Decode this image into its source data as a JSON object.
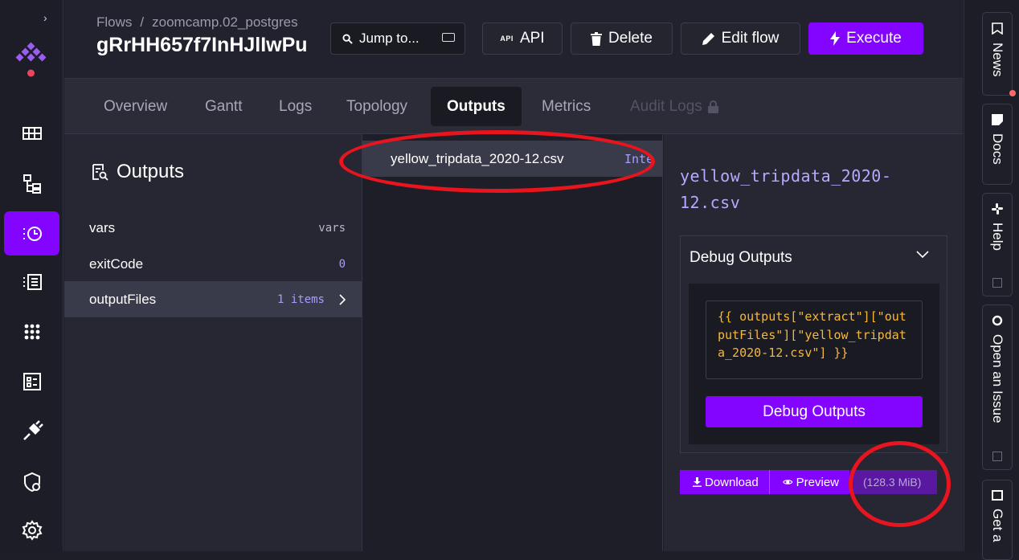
{
  "breadcrumb": {
    "root": "Flows",
    "separator": "/",
    "namespace": "zoomcamp.02_postgres"
  },
  "flow_title": "gRrHH657f7InHJlIwPu",
  "header_buttons": {
    "jump": "Jump to...",
    "api": "API",
    "api_icon_text": "API",
    "delete": "Delete",
    "edit": "Edit flow",
    "execute": "Execute"
  },
  "tabs": [
    {
      "label": "Overview"
    },
    {
      "label": "Gantt"
    },
    {
      "label": "Logs"
    },
    {
      "label": "Topology"
    },
    {
      "label": "Outputs"
    },
    {
      "label": "Metrics"
    },
    {
      "label": "Audit Logs"
    }
  ],
  "outputs_panel": {
    "title": "Outputs",
    "rows": [
      {
        "key": "vars",
        "value": "vars"
      },
      {
        "key": "exitCode",
        "value": "0"
      },
      {
        "key": "outputFiles",
        "value": "1 items"
      }
    ]
  },
  "files": [
    {
      "name": "yellow_tripdata_2020-12.csv",
      "type": "Inte"
    }
  ],
  "detail": {
    "title": "yellow_tripdata_2020-12.csv",
    "debug_header": "Debug Outputs",
    "expression": "{{ outputs[\"extract\"][\"outputFiles\"][\"yellow_tripdata_2020-12.csv\"] }}",
    "debug_button": "Debug Outputs",
    "download": "Download",
    "preview": "Preview",
    "size": "(128.3 MiB)"
  },
  "right_rail": [
    {
      "label": "News"
    },
    {
      "label": "Docs"
    },
    {
      "label": "Help"
    },
    {
      "label": "Open an Issue"
    },
    {
      "label": "Get a"
    }
  ],
  "colors": {
    "accent": "#8405ff",
    "background": "#1d1e27",
    "link": "#b4aaff",
    "code": "#f7b83a",
    "annotation": "#e8141e"
  }
}
